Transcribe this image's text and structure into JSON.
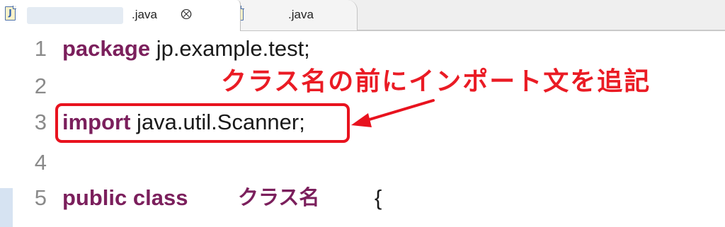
{
  "tabs": [
    {
      "label": ".java",
      "icon": "java-file-icon",
      "active": true,
      "close_icon": "close-icon",
      "close_glyph": "⮾"
    },
    {
      "label": ".java",
      "icon": "java-file-icon",
      "active": false
    }
  ],
  "editor": {
    "lines": [
      {
        "number": "1",
        "keyword": "package",
        "text": " jp.example.test;"
      },
      {
        "number": "2",
        "keyword": "",
        "text": ""
      },
      {
        "number": "3",
        "keyword": "import",
        "text": " java.util.Scanner;"
      },
      {
        "number": "4",
        "keyword": "",
        "text": ""
      },
      {
        "number": "5",
        "keyword": "public class",
        "class_name": "クラス名",
        "brace": "{"
      }
    ]
  },
  "annotation": {
    "callout_text": "クラス名の前にインポート文を追記",
    "color": "#e8121e"
  },
  "colors": {
    "keyword": "#7b1f5c",
    "line_number": "#8a8a8a",
    "annotation": "#e8121e",
    "tab_bar": "#efefef"
  }
}
